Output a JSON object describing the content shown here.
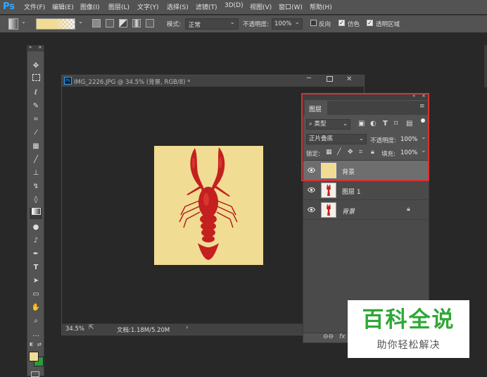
{
  "app": {
    "logo": "Ps"
  },
  "menu": [
    "文件(F)",
    "编辑(E)",
    "图像(I)",
    "图层(L)",
    "文字(Y)",
    "选择(S)",
    "滤镜(T)",
    "3D(D)",
    "视图(V)",
    "窗口(W)",
    "帮助(H)"
  ],
  "options": {
    "mode_label": "模式:",
    "mode_value": "正常",
    "opacity_label": "不透明度:",
    "opacity_value": "100%",
    "reverse_label": "反向",
    "reverse_checked": false,
    "dither_label": "仿色",
    "dither_checked": true,
    "transparency_label": "透明区域",
    "transparency_checked": true
  },
  "document": {
    "title": "IMG_2226.JPG @ 34.5% (背景, RGB/8) *",
    "zoom": "34.5%",
    "doc_info": "文档:1.18M/5.20M"
  },
  "colors": {
    "foreground": "#f1dc93",
    "background": "#2c9c3c",
    "canvas_bg": "#f1dc93",
    "highlight": "#d93232"
  },
  "layers_panel": {
    "tab": "图层",
    "filter_label": "类型",
    "blend_mode": "正片叠底",
    "opacity_label": "不透明度:",
    "opacity_value": "100%",
    "lock_label": "锁定:",
    "fill_label": "填充:",
    "fill_value": "100%",
    "layers": [
      {
        "name": "背景",
        "thumb": "solid-yellow",
        "selected": true,
        "locked": false
      },
      {
        "name": "图层 1",
        "thumb": "lobster",
        "selected": false,
        "locked": false
      },
      {
        "name": "背景",
        "thumb": "lobster",
        "selected": false,
        "locked": true
      }
    ],
    "bottom_links": "fx"
  },
  "watermark": {
    "title": "百科全说",
    "subtitle": "助你轻松解决"
  }
}
